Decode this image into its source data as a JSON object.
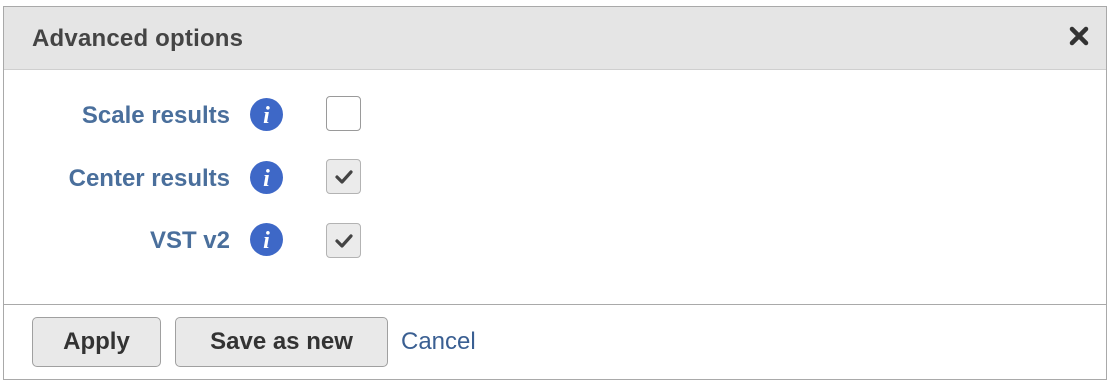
{
  "dialog": {
    "title": "Advanced options",
    "close_icon": "close-icon"
  },
  "options": [
    {
      "label": "Scale results",
      "checked": false,
      "info_icon": "info-icon"
    },
    {
      "label": "Center results",
      "checked": true,
      "info_icon": "info-icon"
    },
    {
      "label": "VST v2",
      "checked": true,
      "info_icon": "info-icon"
    }
  ],
  "footer": {
    "apply_label": "Apply",
    "save_as_new_label": "Save as new",
    "cancel_label": "Cancel"
  },
  "colors": {
    "header_bg": "#e5e5e5",
    "label_text": "#4a6f9c",
    "info_icon": "#3e68c7",
    "link": "#3a5f92",
    "button_bg": "#e9e9e9"
  }
}
